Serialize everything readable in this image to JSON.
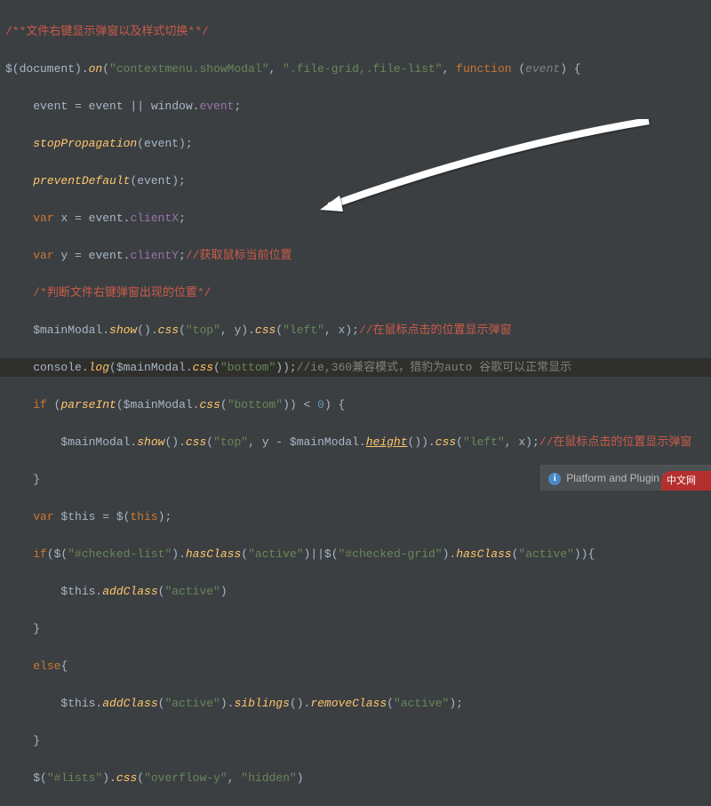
{
  "code": {
    "l1_comment": "/**文件右键显示弹窗以及样式切换**/",
    "l2_a": "$(document).",
    "l2_b": "on",
    "l2_c": "(",
    "l2_d": "\"contextmenu.showModal\"",
    "l2_e": ", ",
    "l2_f": "\".file-grid,.file-list\"",
    "l2_g": ", ",
    "l2_h": "function ",
    "l2_i": "(",
    "l2_j": "event",
    "l2_k": ") {",
    "l3_a": "    event = event || window.",
    "l3_b": "event",
    "l3_c": ";",
    "l4_a": "    ",
    "l4_b": "stopPropagation",
    "l4_c": "(event);",
    "l5_a": "    ",
    "l5_b": "preventDefault",
    "l5_c": "(event);",
    "l6_a": "    ",
    "l6_b": "var ",
    "l6_c": "x = event.",
    "l6_d": "clientX",
    "l6_e": ";",
    "l7_a": "    ",
    "l7_b": "var ",
    "l7_c": "y = event.",
    "l7_d": "clientY",
    "l7_e": ";",
    "l7_f": "//获取鼠标当前位置",
    "l8_a": "    ",
    "l8_b": "/*判断文件右键弹窗出现的位置*/",
    "l9_a": "    $mainModal.",
    "l9_b": "show",
    "l9_c": "().",
    "l9_d": "css",
    "l9_e": "(",
    "l9_f": "\"top\"",
    "l9_g": ", y).",
    "l9_h": "css",
    "l9_i": "(",
    "l9_j": "\"left\"",
    "l9_k": ", x);",
    "l9_l": "//在鼠标点击的位置显示弹窗",
    "l10_a": "    console.",
    "l10_b": "log",
    "l10_c": "($mainModal.",
    "l10_d": "css",
    "l10_e": "(",
    "l10_f": "\"bottom\"",
    "l10_g": "));",
    "l10_h": "//ie,360兼容模式，猎豹为auto 谷歌可以正常显示",
    "l11_a": "    ",
    "l11_b": "if ",
    "l11_c": "(",
    "l11_d": "parseInt",
    "l11_e": "($mainModal.",
    "l11_f": "css",
    "l11_g": "(",
    "l11_h": "\"bottom\"",
    "l11_i": ")) < ",
    "l11_j": "0",
    "l11_k": ") {",
    "l12_a": "        $mainModal.",
    "l12_b": "show",
    "l12_c": "().",
    "l12_d": "css",
    "l12_e": "(",
    "l12_f": "\"top\"",
    "l12_g": ", y - $mainModal.",
    "l12_h": "height",
    "l12_i": "()).",
    "l12_j": "css",
    "l12_k": "(",
    "l12_l": "\"left\"",
    "l12_m": ", x);",
    "l12_n": "//在鼠标点击的位置显示弹窗",
    "l13": "    }",
    "l14_a": "    ",
    "l14_b": "var ",
    "l14_c": "$this = $(",
    "l14_d": "this",
    "l14_e": ");",
    "l15_a": "    ",
    "l15_b": "if",
    "l15_c": "($(",
    "l15_d": "\"#checked-list\"",
    "l15_e": ").",
    "l15_f": "hasClass",
    "l15_g": "(",
    "l15_h": "\"active\"",
    "l15_i": ")||$(",
    "l15_j": "\"#checked-grid\"",
    "l15_k": ").",
    "l15_l": "hasClass",
    "l15_m": "(",
    "l15_n": "\"active\"",
    "l15_o": ")){",
    "l16_a": "        $this.",
    "l16_b": "addClass",
    "l16_c": "(",
    "l16_d": "\"active\"",
    "l16_e": ")",
    "l17": "    }",
    "l18_a": "    ",
    "l18_b": "else",
    "l18_c": "{",
    "l19_a": "        $this.",
    "l19_b": "addClass",
    "l19_c": "(",
    "l19_d": "\"active\"",
    "l19_e": ").",
    "l19_f": "siblings",
    "l19_g": "().",
    "l19_h": "removeClass",
    "l19_i": "(",
    "l19_j": "\"active\"",
    "l19_k": ");",
    "l20": "    }",
    "l21_a": "    $(",
    "l21_b": "\"#lists\"",
    "l21_c": ").",
    "l21_d": "css",
    "l21_e": "(",
    "l21_f": "\"overflow-y\"",
    "l21_g": ", ",
    "l21_h": "\"hidden\"",
    "l21_i": ")"
  },
  "notification": {
    "text": "Platform and Plugin Updates"
  },
  "watermark": {
    "text": "中文网"
  }
}
